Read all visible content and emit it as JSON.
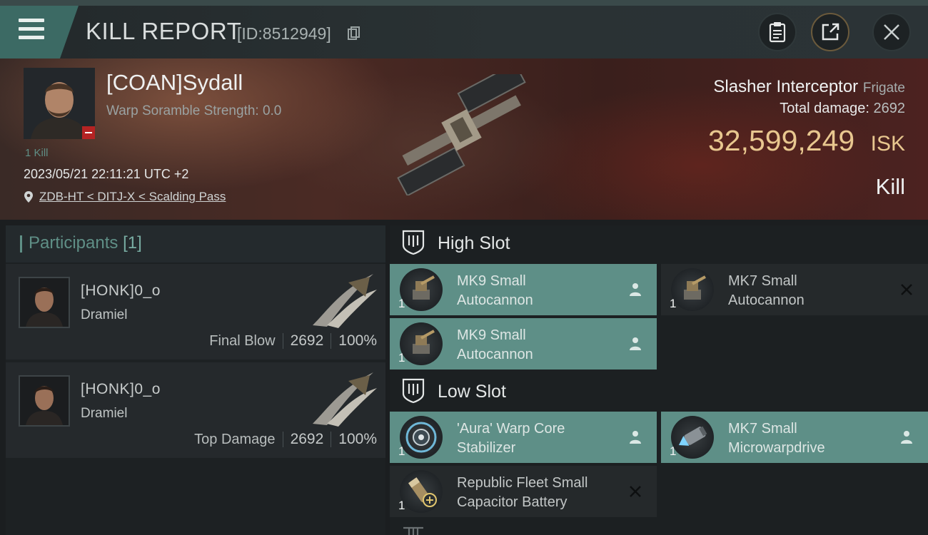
{
  "header": {
    "title": "KILL REPORT",
    "report_id": "[ID:8512949]",
    "icons": [
      "menu-icon",
      "copy-icon",
      "clipboard-icon",
      "share-icon",
      "close-icon"
    ]
  },
  "victim": {
    "name": "[COAN]Sydall",
    "warp_scramble": "Warp Soramble Strength: 0.0",
    "kills": "1 Kill",
    "datetime": "2023/05/21 22:11:21 UTC +2",
    "location": "ZDB-HT < DITJ-X < Scalding Pass",
    "ship_name": "Slasher Interceptor",
    "ship_class": "Frigate",
    "total_damage_label": "Total damage:",
    "total_damage": "2692",
    "isk_value": "32,599,249",
    "isk_unit": "ISK",
    "result": "Kill"
  },
  "participants": {
    "title": "Participants",
    "count": "[1]",
    "cards": [
      {
        "name": "[HONK]0_o",
        "ship": "Dramiel",
        "label": "Final Blow",
        "damage": "2692",
        "percent": "100%"
      },
      {
        "name": "[HONK]0_o",
        "ship": "Dramiel",
        "label": "Top Damage",
        "damage": "2692",
        "percent": "100%"
      }
    ]
  },
  "slots": {
    "high_title": "High Slot",
    "low_title": "Low Slot",
    "modules": [
      {
        "line1": "MK9 Small",
        "line2": "Autocannon",
        "qty": "1",
        "status": "fitted"
      },
      {
        "line1": "MK7 Small",
        "line2": "Autocannon",
        "qty": "1",
        "status": "destroyed"
      },
      {
        "line1": "MK9 Small",
        "line2": "Autocannon",
        "qty": "1",
        "status": "fitted"
      },
      {
        "line1": "'Aura' Warp Core",
        "line2": "Stabilizer",
        "qty": "1",
        "status": "fitted"
      },
      {
        "line1": "MK7 Small",
        "line2": "Microwarpdrive",
        "qty": "1",
        "status": "fitted"
      },
      {
        "line1": "Republic Fleet Small",
        "line2": "Capacitor Battery",
        "qty": "1",
        "status": "destroyed"
      }
    ]
  },
  "colors": {
    "accent": "#5e8f87",
    "isk": "#e8c78f",
    "loss_badge": "#b52323"
  }
}
